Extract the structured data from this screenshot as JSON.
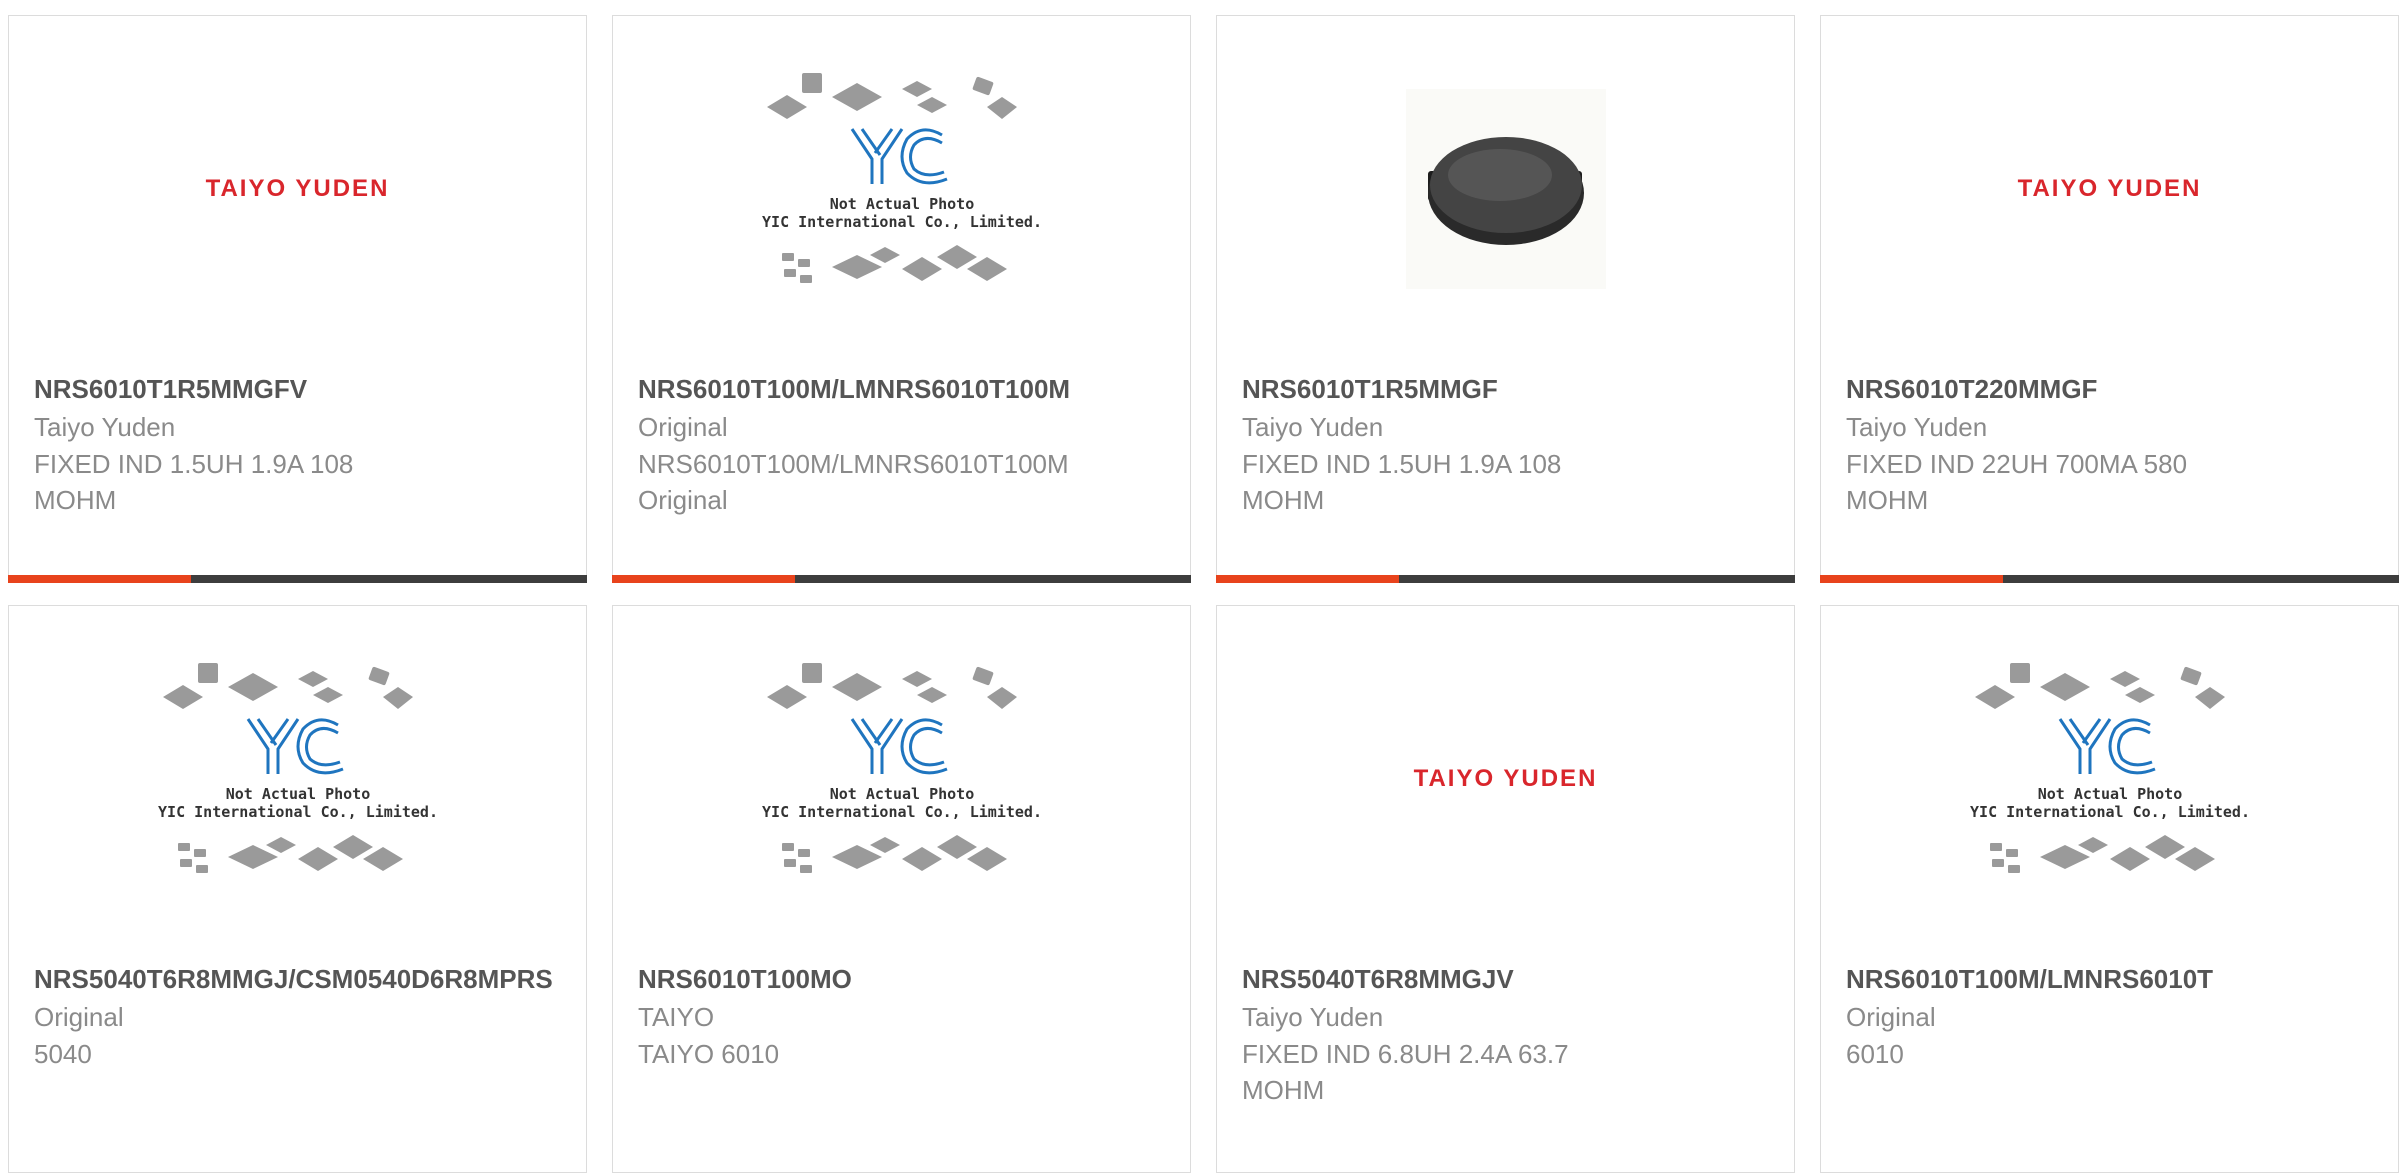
{
  "products": [
    {
      "part_number": "NRS6010T1R5MMGFV",
      "manufacturer": "Taiyo Yuden",
      "description": "FIXED IND 1.5UH 1.9A 108 MOHM",
      "image": "taiyo-yuden-logo",
      "logo_text": "TAIYO YUDEN"
    },
    {
      "part_number": "NRS6010T100M/LMNRS6010T100M",
      "manufacturer": "Original",
      "description": "NRS6010T100M/LMNRS6010T100M Original",
      "image": "yic-placeholder",
      "placeholder_line1": "Not Actual Photo",
      "placeholder_line2": "YIC International Co., Limited."
    },
    {
      "part_number": "NRS6010T1R5MMGF",
      "manufacturer": "Taiyo Yuden",
      "description": "FIXED IND 1.5UH 1.9A 108 MOHM",
      "image": "inductor-photo"
    },
    {
      "part_number": "NRS6010T220MMGF",
      "manufacturer": "Taiyo Yuden",
      "description": "FIXED IND 22UH 700MA 580 MOHM",
      "image": "taiyo-yuden-logo",
      "logo_text": "TAIYO YUDEN"
    },
    {
      "part_number": "NRS5040T6R8MMGJ/CSM0540D6R8MPRS",
      "manufacturer": "Original",
      "description": "5040",
      "image": "yic-placeholder",
      "placeholder_line1": "Not Actual Photo",
      "placeholder_line2": "YIC International Co., Limited."
    },
    {
      "part_number": "NRS6010T100MO",
      "manufacturer": "TAIYO",
      "description": "TAIYO 6010",
      "image": "yic-placeholder",
      "placeholder_line1": "Not Actual Photo",
      "placeholder_line2": "YIC International Co., Limited."
    },
    {
      "part_number": "NRS5040T6R8MMGJV",
      "manufacturer": "Taiyo Yuden",
      "description": "FIXED IND 6.8UH 2.4A 63.7 MOHM",
      "image": "taiyo-yuden-logo",
      "logo_text": "TAIYO YUDEN"
    },
    {
      "part_number": "NRS6010T100M/LMNRS6010T",
      "manufacturer": "Original",
      "description": "6010",
      "image": "yic-placeholder",
      "placeholder_line1": "Not Actual Photo",
      "placeholder_line2": "YIC International Co., Limited."
    }
  ],
  "colors": {
    "accent": "#e8431c",
    "bar": "#3d3d3d",
    "logo_red": "#d9262c",
    "yic_blue": "#1f75bf"
  }
}
